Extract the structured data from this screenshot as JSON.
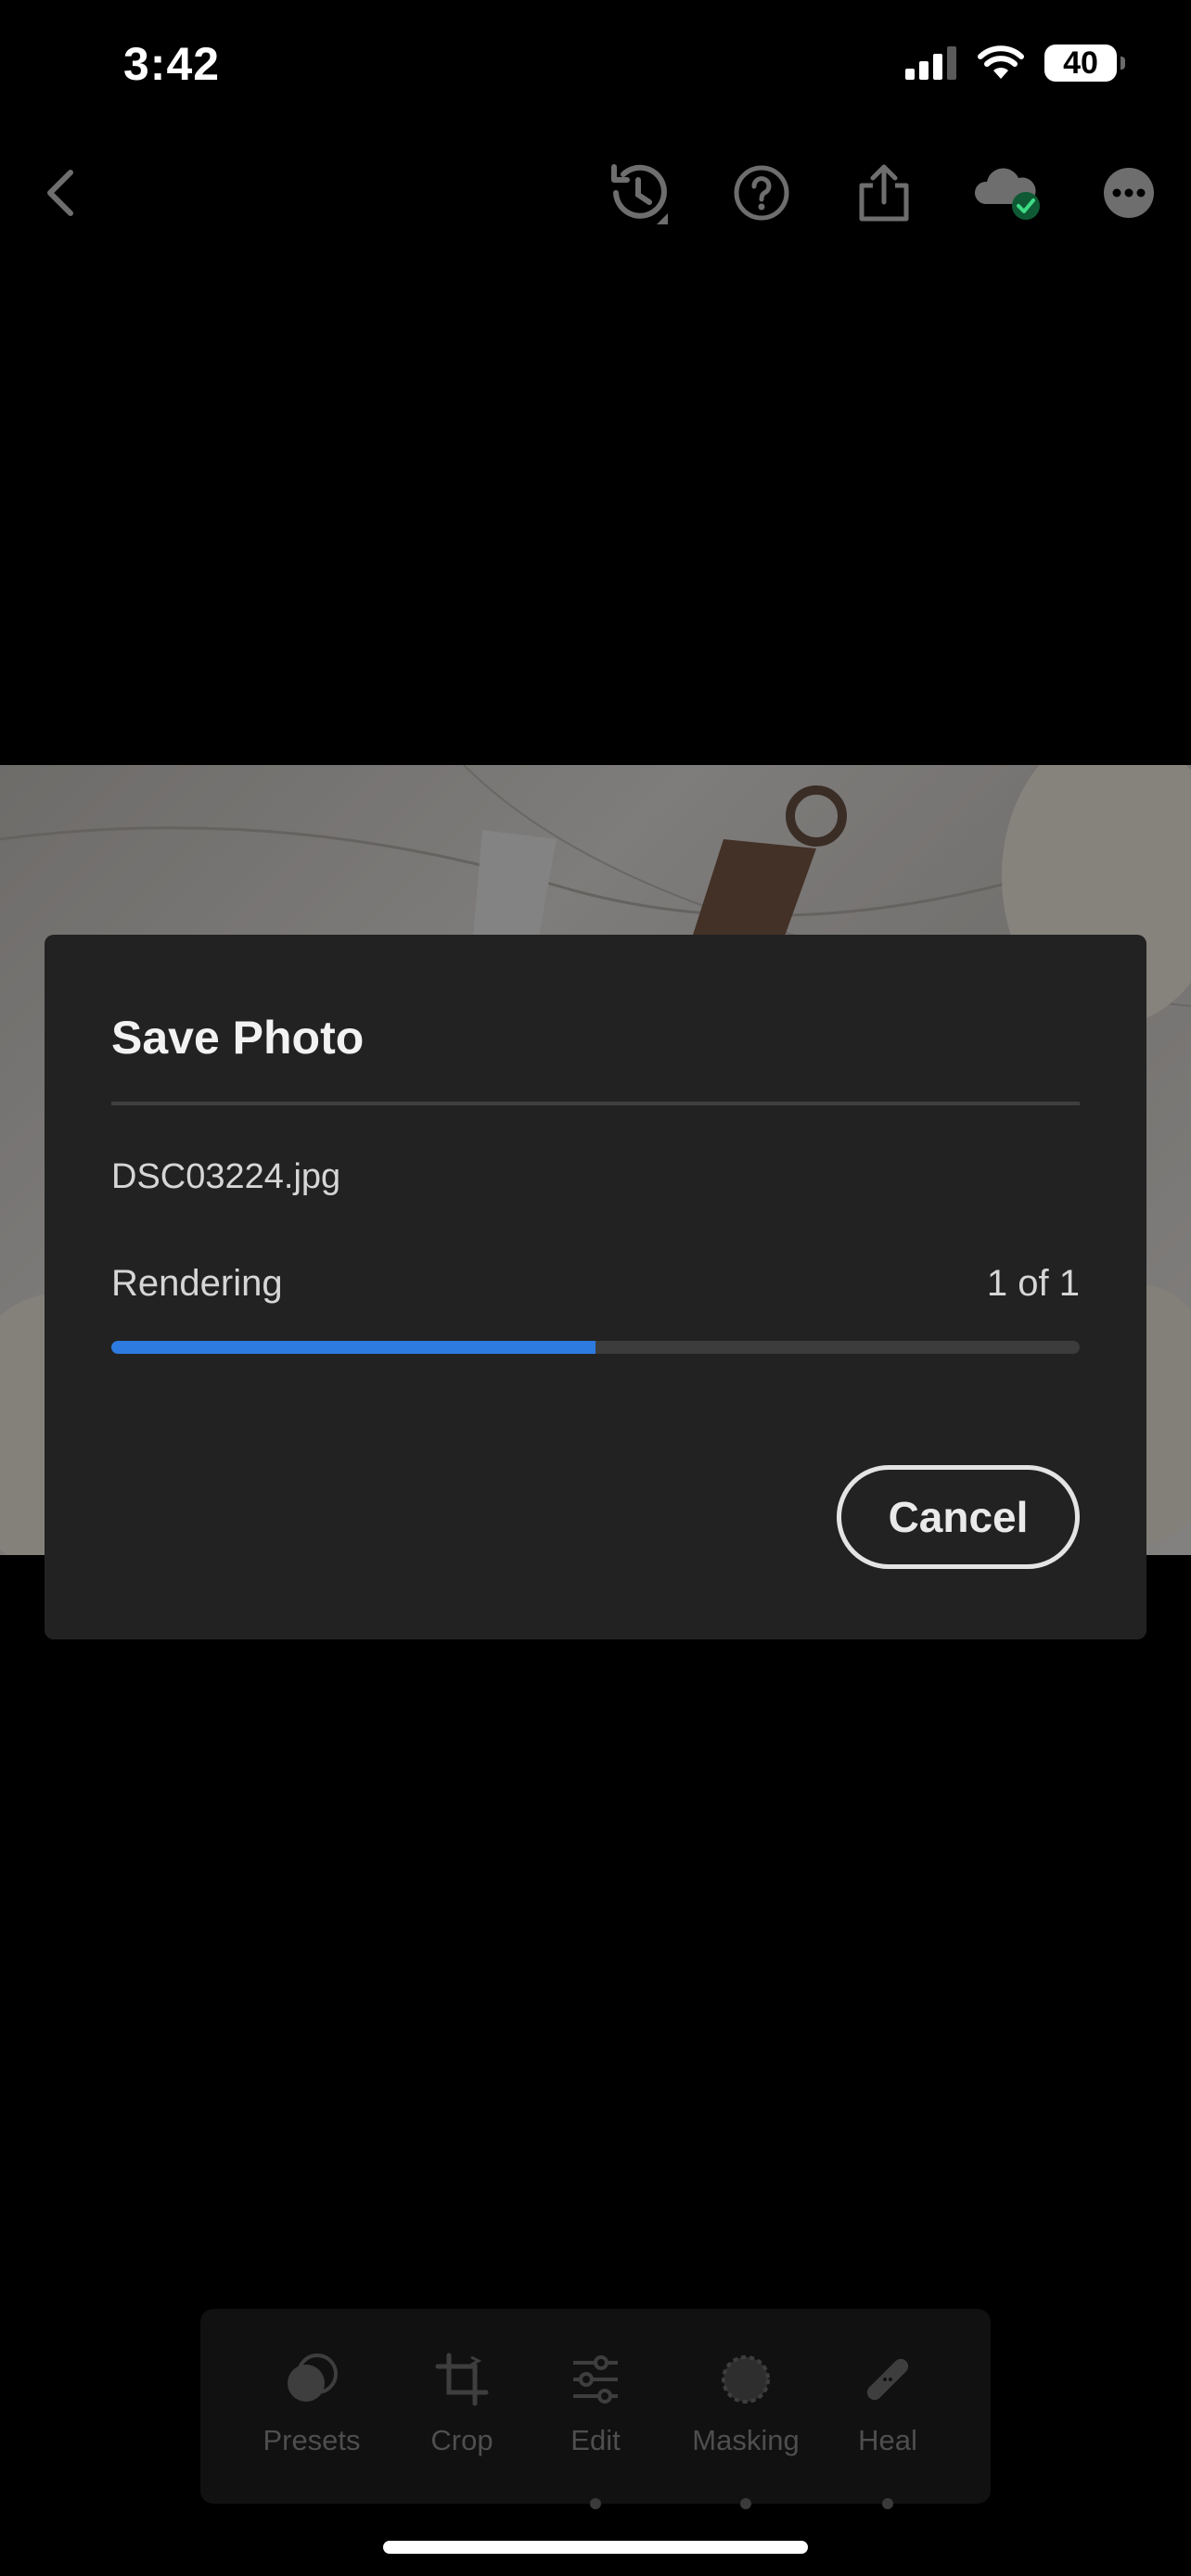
{
  "status_bar": {
    "time": "3:42",
    "battery": "40",
    "icons": [
      "signal-icon",
      "wifi-icon",
      "battery-icon"
    ]
  },
  "toolbar": {
    "icons": [
      "back-icon",
      "history-icon",
      "help-icon",
      "share-icon",
      "cloud-synced-icon",
      "more-icon"
    ]
  },
  "dialog": {
    "title": "Save Photo",
    "file_name": "DSC03224.jpg",
    "status": "Rendering",
    "count": "1 of 1",
    "progress": 0.5,
    "cancel_label": "Cancel",
    "accent": "#2d7be0"
  },
  "tools": [
    {
      "label": "Presets",
      "icon": "presets-icon"
    },
    {
      "label": "Crop",
      "icon": "crop-icon"
    },
    {
      "label": "Edit",
      "icon": "edit-sliders-icon"
    },
    {
      "label": "Masking",
      "icon": "masking-icon"
    },
    {
      "label": "Heal",
      "icon": "heal-bandage-icon"
    }
  ]
}
